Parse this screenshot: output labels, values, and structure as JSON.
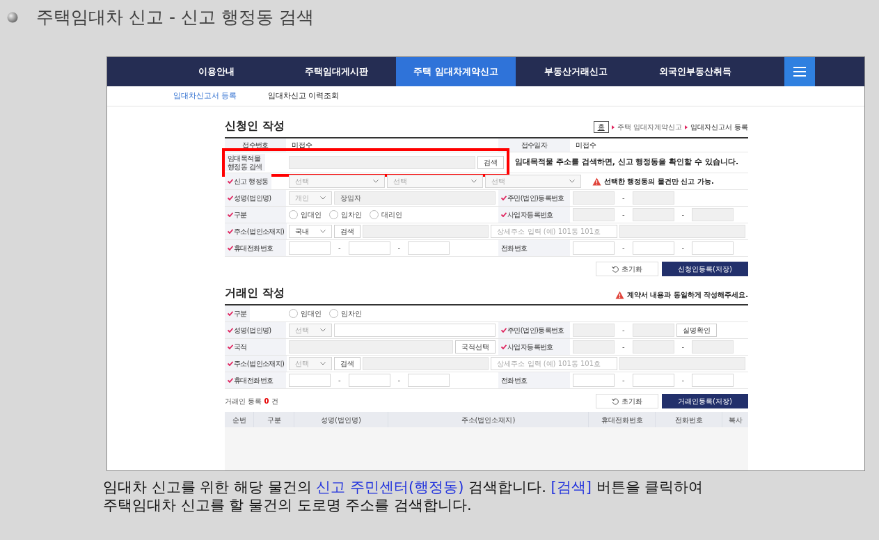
{
  "slide_title": "주택임대차 신고 - 신고 행정동 검색",
  "nav": [
    {
      "label": "이용안내",
      "selected": false
    },
    {
      "label": "주택임대게시판",
      "selected": false
    },
    {
      "label": "주택 임대차계약신고",
      "selected": true
    },
    {
      "label": "부동산거래신고",
      "selected": false
    },
    {
      "label": "외국인부동산취득",
      "selected": false
    }
  ],
  "subnav": [
    {
      "label": "임대차신고서 등록",
      "selected": true
    },
    {
      "label": "임대차신고 이력조회",
      "selected": false
    }
  ],
  "applicant": {
    "title": "신청인 작성",
    "breadcrumb": [
      "홈",
      "주택 임대자계약신고",
      "임대자신고서 등록"
    ],
    "rows": [
      {
        "label": "접수번호",
        "required": false,
        "items": [
          {
            "kind": "text",
            "text": "미접수"
          }
        ],
        "label_2": "접수일자",
        "required_2": false,
        "items_2": [
          {
            "kind": "text",
            "text": "미접수"
          }
        ]
      },
      {
        "label": "임대목적물\n행정동 검색",
        "required": false,
        "highlighted": true,
        "items": [
          {
            "kind": "field",
            "value": "",
            "disabled": true
          },
          {
            "kind": "button",
            "label": "검색"
          }
        ],
        "note": {
          "kind": "notice",
          "text": "임대목적물 주소를 검색하면, 신고 행정동을 확인할 수 있습니다."
        }
      },
      {
        "label": "신고 행정동",
        "required": true,
        "highlighted": false,
        "items": [
          {
            "kind": "combo",
            "value": "선택",
            "disabled": true
          },
          {
            "kind": "combo",
            "value": "선택",
            "disabled": true
          },
          {
            "kind": "combo",
            "value": "선택",
            "disabled": true
          }
        ],
        "note": {
          "kind": "warning",
          "text": "선택한 행정동의 물건만 신고 가능."
        }
      },
      {
        "label": "성명(법인명)",
        "required": true,
        "items": [
          {
            "kind": "select",
            "value": "개인",
            "disabled": true
          },
          {
            "kind": "field",
            "value": "장임자",
            "disabled": true
          }
        ],
        "label_2": "주민(법인)등록번호",
        "required_2": true,
        "items_2": [
          {
            "kind": "input",
            "disabled": true
          },
          {
            "kind": "dash",
            "text": "-"
          },
          {
            "kind": "input",
            "disabled": true
          }
        ]
      },
      {
        "label": "구분",
        "required": true,
        "items": [
          {
            "kind": "radio",
            "label": "임대인",
            "checked": false
          },
          {
            "kind": "radio",
            "label": "임차인",
            "checked": false
          },
          {
            "kind": "radio",
            "label": "대리인",
            "checked": false
          }
        ],
        "label_2": "사업자등록번호",
        "required_2": true,
        "items_2": [
          {
            "kind": "input",
            "disabled": true
          },
          {
            "kind": "dash",
            "text": "-"
          },
          {
            "kind": "input",
            "disabled": true
          },
          {
            "kind": "dash",
            "text": "-"
          },
          {
            "kind": "input",
            "disabled": true
          }
        ]
      },
      {
        "label": "주소(법인소재지)",
        "required": true,
        "highlighted": false,
        "items": [
          {
            "kind": "select",
            "value": "국내",
            "disabled": false
          },
          {
            "kind": "button",
            "label": "검색"
          },
          {
            "kind": "field",
            "disabled": true
          },
          {
            "kind": "field",
            "placeholder": "상세주소 입력 (예) 101동 101호",
            "disabled": false
          },
          {
            "kind": "field",
            "disabled": true
          }
        ]
      },
      {
        "label": "휴대전화번호",
        "required": true,
        "items": [
          {
            "kind": "input",
            "disabled": false
          },
          {
            "kind": "dash",
            "text": "-"
          },
          {
            "kind": "input",
            "disabled": false
          },
          {
            "kind": "dash",
            "text": "-"
          },
          {
            "kind": "input",
            "disabled": false
          }
        ],
        "label_2": "전화번호",
        "required_2": false,
        "items_2": [
          {
            "kind": "input",
            "disabled": false
          },
          {
            "kind": "dash",
            "text": "-"
          },
          {
            "kind": "input",
            "disabled": false
          },
          {
            "kind": "dash",
            "text": "-"
          },
          {
            "kind": "input",
            "disabled": false
          }
        ]
      }
    ],
    "buttons": [
      {
        "kind": "reset",
        "label": "초기화"
      },
      {
        "kind": "save",
        "label": "신청인등록(저장)"
      }
    ]
  },
  "trader": {
    "title": "거래인 작성",
    "warning": "계약서 내용과 동일하게 작성해주세요.",
    "rows": [
      {
        "label": "구분",
        "required": true,
        "highlighted": false,
        "items": [
          {
            "kind": "radio",
            "label": "임대인",
            "checked": false
          },
          {
            "kind": "radio",
            "label": "임차인",
            "checked": false
          }
        ]
      },
      {
        "label": "성명(법인명)",
        "required": true,
        "items": [
          {
            "kind": "select",
            "value": "선택",
            "disabled": true
          },
          {
            "kind": "field",
            "disabled": false
          }
        ],
        "label_2": "주민(법인)등록번호",
        "required_2": true,
        "items_2": [
          {
            "kind": "input",
            "disabled": true
          },
          {
            "kind": "dash",
            "text": "-"
          },
          {
            "kind": "input",
            "disabled": true
          },
          {
            "kind": "button",
            "label": "실명확인"
          }
        ]
      },
      {
        "label": "국적",
        "required": true,
        "items": [
          {
            "kind": "field",
            "disabled": true
          },
          {
            "kind": "button",
            "label": "국적선택"
          }
        ],
        "label_2": "사업자등록번호",
        "required_2": true,
        "items_2": [
          {
            "kind": "input",
            "disabled": true
          },
          {
            "kind": "dash",
            "text": "-"
          },
          {
            "kind": "input",
            "disabled": true
          },
          {
            "kind": "dash",
            "text": "-"
          },
          {
            "kind": "input",
            "disabled": true
          }
        ]
      },
      {
        "label": "주소(법인소재지)",
        "required": true,
        "highlighted": false,
        "items": [
          {
            "kind": "select",
            "value": "선택",
            "disabled": true
          },
          {
            "kind": "button",
            "label": "검색"
          },
          {
            "kind": "field",
            "disabled": true
          },
          {
            "kind": "field",
            "placeholder": "상세주소 입력 (예) 101동 101호",
            "disabled": false
          },
          {
            "kind": "field",
            "disabled": true
          }
        ]
      },
      {
        "label": "휴대전화번호",
        "required": true,
        "items": [
          {
            "kind": "input",
            "disabled": false
          },
          {
            "kind": "dash",
            "text": "-"
          },
          {
            "kind": "input",
            "disabled": false
          },
          {
            "kind": "dash",
            "text": "-"
          },
          {
            "kind": "input",
            "disabled": false
          }
        ],
        "label_2": "전화번호",
        "required_2": false,
        "items_2": [
          {
            "kind": "input",
            "disabled": false
          },
          {
            "kind": "dash",
            "text": "-"
          },
          {
            "kind": "input",
            "disabled": false
          },
          {
            "kind": "dash",
            "text": "-"
          },
          {
            "kind": "input",
            "disabled": false
          }
        ]
      }
    ],
    "count": {
      "prefix": "거래인 등록",
      "value": "0",
      "suffix": "건"
    },
    "buttons": [
      {
        "kind": "reset",
        "label": "초기화"
      },
      {
        "kind": "save",
        "label": "거래인등록(저장)"
      }
    ],
    "table": {
      "columns": [
        "순번",
        "구분",
        "성명(법인명)",
        "주소(법인소재지)",
        "휴대전화번호",
        "전화번호",
        "복사"
      ]
    }
  },
  "caption": [
    [
      {
        "text": "임대차 신고를 위한 해당 물건의 ",
        "highlight": false
      },
      {
        "text": "신고 주민센터(행정동)",
        "highlight": true
      },
      {
        "text": " 검색합니다. ",
        "highlight": false
      },
      {
        "text": "[검색]",
        "highlight": true
      },
      {
        "text": " 버튼을 클릭하여",
        "highlight": false
      }
    ],
    [
      {
        "text": "주택임대차 신고를 할 물건의 도로명 주소를 검색합니다.",
        "highlight": false
      }
    ]
  ]
}
